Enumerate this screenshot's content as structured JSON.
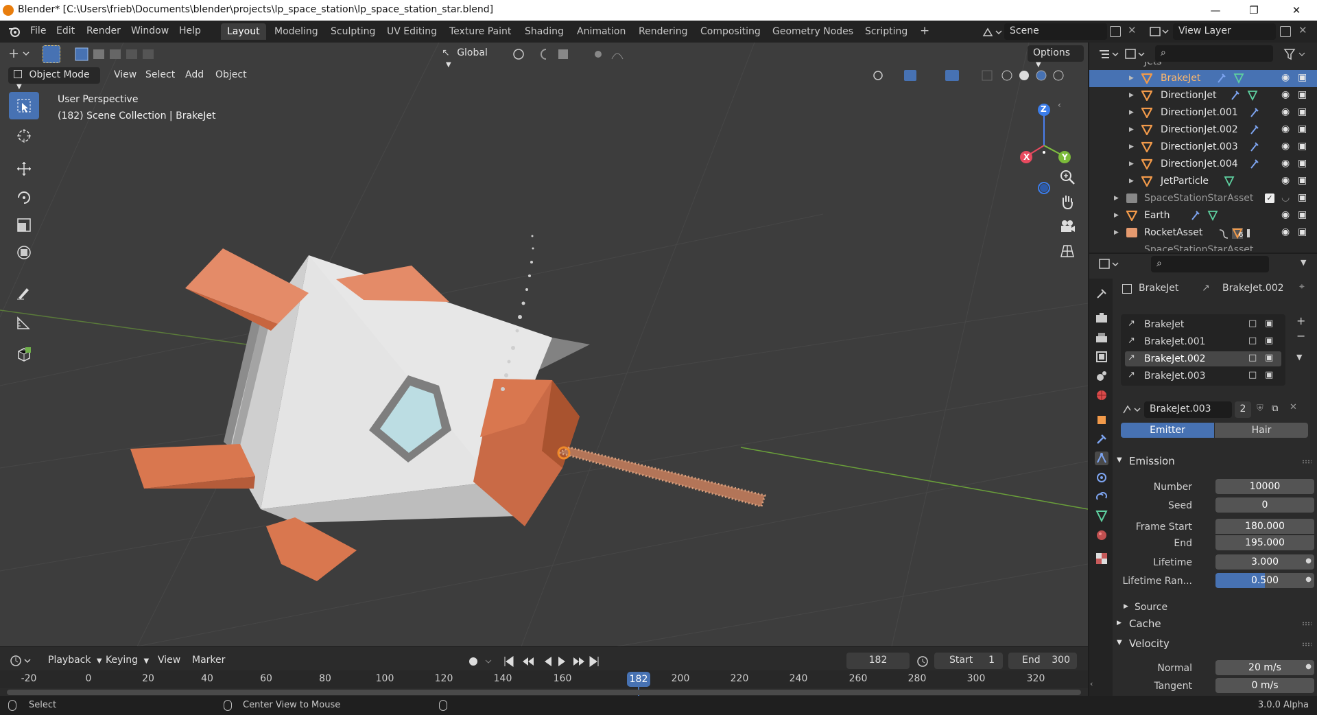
{
  "window": {
    "title": "Blender* [C:\\Users\\frieb\\Documents\\blender\\projects\\lp_space_station\\lp_space_station_star.blend]"
  },
  "menus": [
    "File",
    "Edit",
    "Render",
    "Window",
    "Help"
  ],
  "workspaces": [
    "Layout",
    "Modeling",
    "Sculpting",
    "UV Editing",
    "Texture Paint",
    "Shading",
    "Animation",
    "Rendering",
    "Compositing",
    "Geometry Nodes",
    "Scripting"
  ],
  "active_workspace": "Layout",
  "scene": {
    "name": "Scene",
    "view_layer": "View Layer"
  },
  "viewport": {
    "mode": "Object Mode",
    "header_menus": [
      "View",
      "Select",
      "Add",
      "Object"
    ],
    "transform_orientation": "Global",
    "options_label": "Options",
    "perspective_label": "User Perspective",
    "collection_label": "(182) Scene Collection | BrakeJet",
    "gizmo": {
      "z": "Z",
      "x": "X",
      "y": "Y"
    }
  },
  "outliner": {
    "partial_top": "Jets",
    "rows": [
      {
        "name": "BrakeJet",
        "selected": true
      },
      {
        "name": "DirectionJet",
        "selected": false
      },
      {
        "name": "DirectionJet.001",
        "selected": false
      },
      {
        "name": "DirectionJet.002",
        "selected": false
      },
      {
        "name": "DirectionJet.003",
        "selected": false
      },
      {
        "name": "DirectionJet.004",
        "selected": false
      },
      {
        "name": "JetParticle",
        "selected": false
      },
      {
        "name": "SpaceStationStarAsset",
        "selected": false
      },
      {
        "name": "Earth",
        "selected": false
      },
      {
        "name": "RocketAsset",
        "selected": false
      }
    ],
    "partial_bottom": "SpaceStationStarAsset",
    "rocket_badge": "6"
  },
  "properties": {
    "breadcrumb_object": "BrakeJet",
    "breadcrumb_system": "BrakeJet.002",
    "particle_systems": [
      "BrakeJet",
      "BrakeJet.001",
      "BrakeJet.002",
      "BrakeJet.003"
    ],
    "active_system_index": 2,
    "settings_name": "BrakeJet.003",
    "settings_users": "2",
    "type_tabs": [
      "Emitter",
      "Hair"
    ],
    "active_type": "Emitter",
    "emission": {
      "header": "Emission",
      "fields": [
        {
          "label": "Number",
          "value": "10000"
        },
        {
          "label": "Seed",
          "value": "0"
        },
        {
          "label": "Frame Start",
          "value": "180.000"
        },
        {
          "label": "End",
          "value": "195.000"
        },
        {
          "label": "Lifetime",
          "value": "3.000"
        },
        {
          "label": "Lifetime Ran...",
          "value": "0.500"
        }
      ],
      "lifetime_random_fraction": 0.5
    },
    "source_label": "Source",
    "cache_label": "Cache",
    "velocity": {
      "header": "Velocity",
      "fields": [
        {
          "label": "Normal",
          "value": "20 m/s"
        },
        {
          "label": "Tangent",
          "value": "0 m/s"
        }
      ]
    }
  },
  "timeline": {
    "menus": [
      "Playback",
      "Keying",
      "View",
      "Marker"
    ],
    "current_frame": "182",
    "start_label": "Start",
    "start": "1",
    "end_label": "End",
    "end": "300",
    "ruler": [
      "-20",
      "0",
      "20",
      "40",
      "60",
      "80",
      "100",
      "120",
      "140",
      "160",
      "200",
      "220",
      "240",
      "260",
      "280",
      "300",
      "320"
    ]
  },
  "statusbar": {
    "left": "Select",
    "middle": "Center View to Mouse",
    "version": "3.0.0 Alpha"
  },
  "colors": {
    "accent": "#4772b3",
    "orange": "#d9774f",
    "frame_marker": "#4772b3"
  }
}
